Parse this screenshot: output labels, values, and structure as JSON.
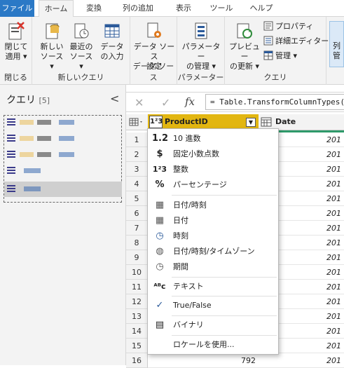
{
  "tabs": [
    "ファイル",
    "ホーム",
    "変換",
    "列の追加",
    "表示",
    "ツール",
    "ヘルプ"
  ],
  "ribbon": {
    "close_apply": [
      "閉じて",
      "適用 ▾"
    ],
    "close_group": "閉じる",
    "new_source": [
      "新しい",
      "ソース ▾"
    ],
    "recent_sources": [
      "最近の",
      "ソース ▾"
    ],
    "enter_data": [
      "データ",
      "の入力"
    ],
    "new_query_group": "新しいクエリ",
    "data_source_settings": [
      "データ ソース",
      "設定"
    ],
    "data_source_group": "データ ソース",
    "manage_params": [
      "パラメーター",
      "の管理 ▾"
    ],
    "params_group": "パラメーター",
    "refresh_preview": [
      "プレビュー",
      "の更新 ▾"
    ],
    "properties": "プロパティ",
    "advanced_editor": "詳細エディター",
    "manage": "管理 ▾",
    "query_group": "クエリ",
    "right_cut": [
      "列",
      "管"
    ]
  },
  "query_pane": {
    "title": "クエリ",
    "count": "[5]",
    "collapse": "<"
  },
  "formula_bar": {
    "cancel": "✕",
    "commit": "✓",
    "fx": "fx",
    "formula": "= Table.TransformColumnTypes("
  },
  "grid": {
    "columns": [
      "ProductID",
      "Date"
    ],
    "rows": [
      "1",
      "2",
      "3",
      "4",
      "5",
      "6",
      "7",
      "8",
      "9",
      "10",
      "11",
      "12",
      "13",
      "14",
      "15",
      "16"
    ],
    "date_cell": "201",
    "last_value": "792"
  },
  "type_menu": {
    "items": [
      {
        "icon": "1.2",
        "label": "10 進数"
      },
      {
        "icon": "$",
        "label": "固定小数点数"
      },
      {
        "icon": "1²3",
        "label": "整数"
      },
      {
        "icon": "%",
        "label": "パーセンテージ"
      },
      {
        "icon": "▦",
        "label": "日付/時刻"
      },
      {
        "icon": "▦",
        "label": "日付"
      },
      {
        "icon": "◷",
        "label": "時刻"
      },
      {
        "icon": "◍",
        "label": "日付/時刻/タイムゾーン"
      },
      {
        "icon": "◷",
        "label": "期間"
      },
      {
        "icon": "ᴬᴮc",
        "label": "テキスト"
      },
      {
        "icon": "✓",
        "label": "True/False"
      },
      {
        "icon": "▤",
        "label": "バイナリ"
      },
      {
        "icon": "",
        "label": "ロケールを使用..."
      }
    ]
  },
  "colors": {
    "accent": "#2b79c6",
    "header_active": "#e2b611",
    "selection": "#cfcfcf"
  }
}
